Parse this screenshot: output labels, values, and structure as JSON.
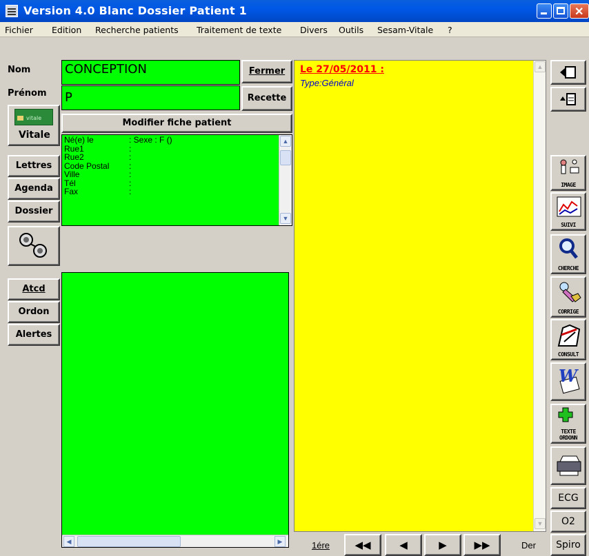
{
  "window": {
    "title": "Version 4.0 Blanc  Dossier Patient 1"
  },
  "menu": [
    "Fichier",
    "Edition",
    "Recherche patients",
    "Traitement de texte",
    "Divers",
    "Outils",
    "Sesam-Vitale",
    "?"
  ],
  "patient": {
    "nom_label": "Nom",
    "nom_value": "CONCEPTION",
    "prenom_label": "Prénom",
    "prenom_value": "P",
    "fermer": "Fermer",
    "recette": "Recette",
    "modifier": "Modifier fiche patient",
    "info": [
      {
        "label": "Né(e) le",
        "value": ": Sexe : F ()"
      },
      {
        "label": "Rue1",
        "value": ":"
      },
      {
        "label": "Rue2",
        "value": ":"
      },
      {
        "label": "Code Postal",
        "value": ":"
      },
      {
        "label": "Ville",
        "value": ":"
      },
      {
        "label": "Tél",
        "value": ":"
      },
      {
        "label": "Fax",
        "value": ":"
      }
    ]
  },
  "left_buttons": {
    "vitale": "Vitale",
    "card_text": "vitale",
    "lettres": "Lettres",
    "agenda": "Agenda",
    "dossier": "Dossier",
    "atcd": "Atcd",
    "ordon": "Ordon",
    "alertes": "Alertes"
  },
  "record": {
    "date_heading": "Le 27/05/2011 :",
    "type_line": "Type:Général"
  },
  "nav": {
    "first": "1ére",
    "last": "Der"
  },
  "tools": [
    {
      "name": "image",
      "caption": "IMAGE"
    },
    {
      "name": "suivi",
      "caption": "SUIVI"
    },
    {
      "name": "cherche",
      "caption": "CHERCHE"
    },
    {
      "name": "corrige",
      "caption": "CORRIGE"
    },
    {
      "name": "consult",
      "caption": "CONSULT"
    },
    {
      "name": "word",
      "caption": ""
    },
    {
      "name": "texte",
      "caption": "TEXTE ORDONN"
    },
    {
      "name": "print",
      "caption": ""
    }
  ],
  "tool_labels": {
    "ecg": "ECG",
    "o2": "O2",
    "spiro": "Spiro"
  },
  "colors": {
    "patient_green": "#00ff00",
    "record_yellow": "#ffff00",
    "date_red": "#ff0000",
    "type_blue": "#0000cc",
    "title_blue": "#0058e6"
  }
}
